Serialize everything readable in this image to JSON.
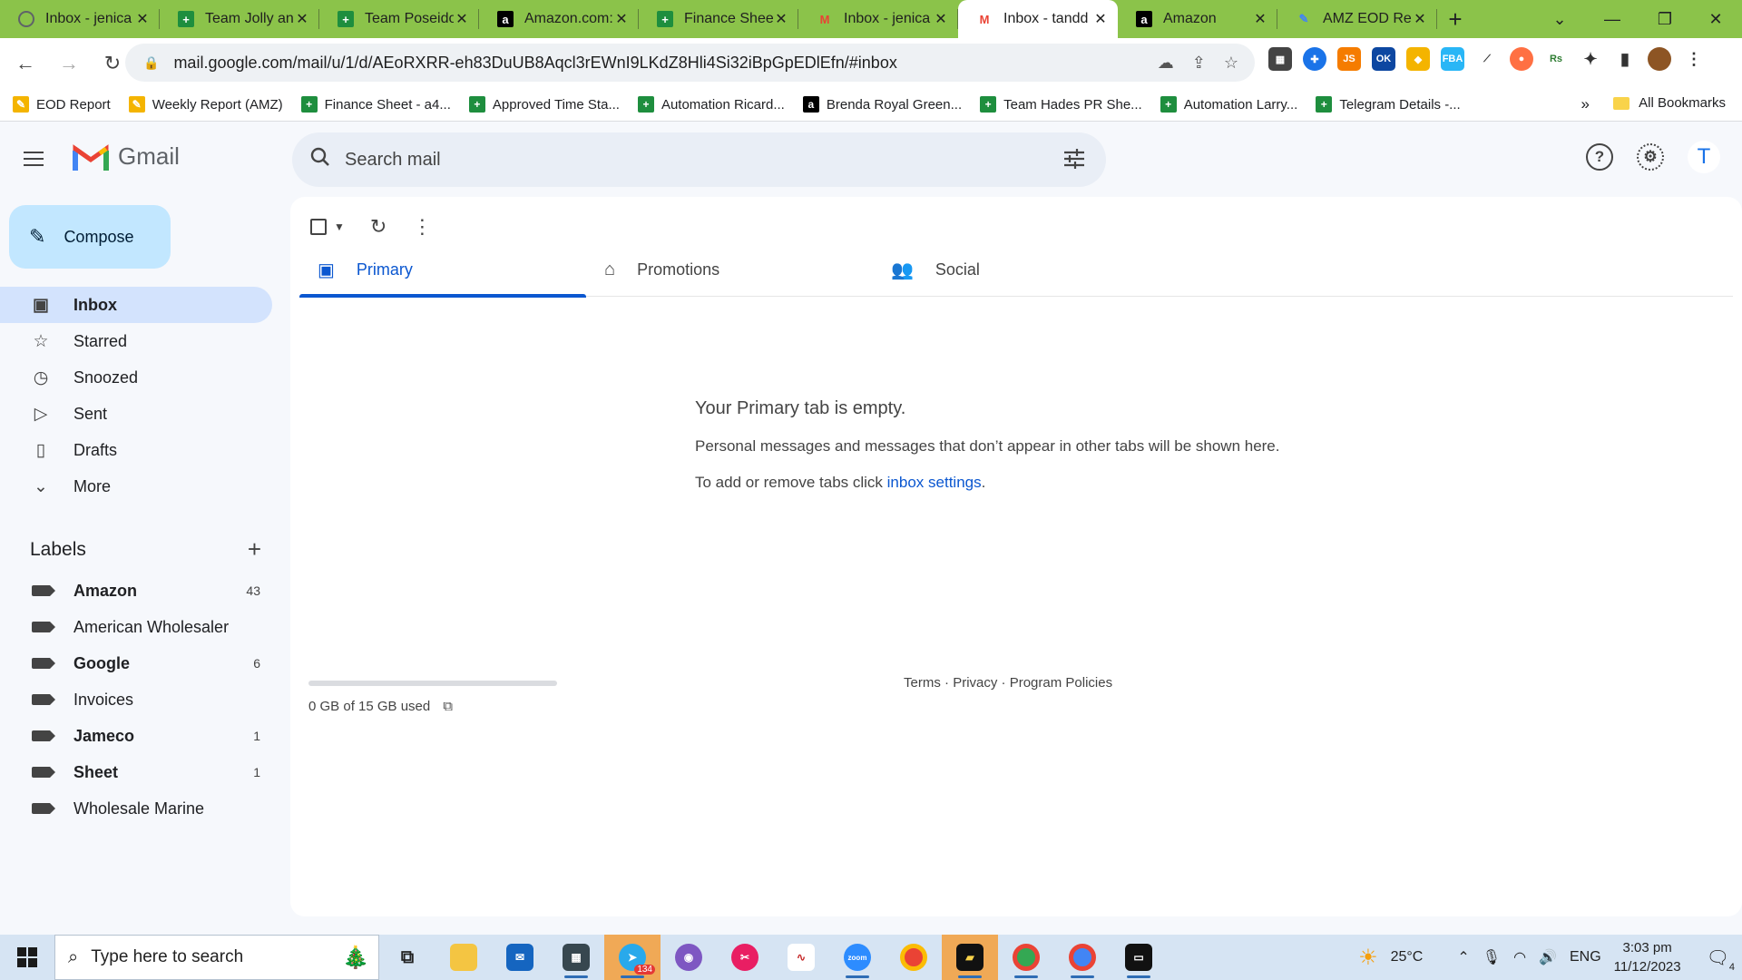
{
  "browser": {
    "tabs": [
      {
        "title": "Inbox - jenica",
        "favicon": "gear-icon"
      },
      {
        "title": "Team Jolly an",
        "favicon": "sheets-icon"
      },
      {
        "title": "Team Poseido",
        "favicon": "sheets-icon"
      },
      {
        "title": "Amazon.com:",
        "favicon": "amazon-icon"
      },
      {
        "title": "Finance Sheet",
        "favicon": "sheets-icon"
      },
      {
        "title": "Inbox - jenica",
        "favicon": "gmail-icon"
      },
      {
        "title": "Inbox - tandd",
        "favicon": "gmail-icon",
        "active": true
      },
      {
        "title": "Amazon",
        "favicon": "amazon-icon"
      },
      {
        "title": "AMZ EOD Re",
        "favicon": "pen-icon"
      }
    ],
    "new_tab": "+",
    "url": "mail.google.com/mail/u/1/d/AEoRXRR-eh83DuUB8Aqcl3rEWnI9LKdZ8Hli4Si32iBpGpEDlEfn/#inbox",
    "bookmarks": [
      {
        "label": "EOD Report",
        "icon": "pen-icon",
        "color": "#f4b400"
      },
      {
        "label": "Weekly Report (AMZ)",
        "icon": "pen-icon",
        "color": "#f4b400"
      },
      {
        "label": "Finance Sheet - a4...",
        "icon": "sheets-icon",
        "color": "#1e8e3e"
      },
      {
        "label": "Approved Time Sta...",
        "icon": "sheets-icon",
        "color": "#1e8e3e"
      },
      {
        "label": "Automation Ricard...",
        "icon": "sheets-icon",
        "color": "#1e8e3e"
      },
      {
        "label": "Brenda Royal Green...",
        "icon": "amazon-icon",
        "color": "#000000"
      },
      {
        "label": "Team Hades PR She...",
        "icon": "sheets-icon",
        "color": "#1e8e3e"
      },
      {
        "label": "Automation Larry...",
        "icon": "sheets-icon",
        "color": "#1e8e3e"
      },
      {
        "label": "Telegram Details -...",
        "icon": "sheets-icon",
        "color": "#1e8e3e"
      }
    ],
    "bookmarks_more": "»",
    "all_bookmarks": "All Bookmarks"
  },
  "gmail": {
    "logo_text": "Gmail",
    "search_placeholder": "Search mail",
    "avatar_letter": "T",
    "compose_label": "Compose",
    "nav": [
      {
        "label": "Inbox",
        "icon": "inbox-icon",
        "active": true
      },
      {
        "label": "Starred",
        "icon": "star-icon"
      },
      {
        "label": "Snoozed",
        "icon": "clock-icon"
      },
      {
        "label": "Sent",
        "icon": "send-icon"
      },
      {
        "label": "Drafts",
        "icon": "draft-icon"
      },
      {
        "label": "More",
        "icon": "chevron-down-icon"
      }
    ],
    "labels_title": "Labels",
    "labels": [
      {
        "name": "Amazon",
        "count": "43",
        "bold": true
      },
      {
        "name": "American Wholesaler",
        "count": "",
        "bold": false
      },
      {
        "name": "Google",
        "count": "6",
        "bold": true
      },
      {
        "name": "Invoices",
        "count": "",
        "bold": false
      },
      {
        "name": "Jameco",
        "count": "1",
        "bold": true
      },
      {
        "name": "Sheet",
        "count": "1",
        "bold": true
      },
      {
        "name": "Wholesale Marine",
        "count": "",
        "bold": false
      }
    ],
    "inbox_tabs": [
      {
        "label": "Primary",
        "icon": "inbox-icon",
        "active": true
      },
      {
        "label": "Promotions",
        "icon": "tag-icon"
      },
      {
        "label": "Social",
        "icon": "people-icon"
      }
    ],
    "empty": {
      "heading": "Your Primary tab is empty.",
      "line1": "Personal messages and messages that don’t appear in other tabs will be shown here.",
      "line2_prefix": "To add or remove tabs click ",
      "line2_link": "inbox settings",
      "line2_suffix": "."
    },
    "storage": {
      "text": "0 GB of 15 GB used",
      "used_fraction": 0
    },
    "footer": {
      "terms": "Terms",
      "privacy": "Privacy",
      "policies": "Program Policies",
      "sep": " · "
    }
  },
  "taskbar": {
    "search_placeholder": "Type here to search",
    "telegram_badge": "134",
    "weather": "25°C",
    "language": "ENG",
    "time": "3:03 pm",
    "date": "11/12/2023",
    "notifications": "4"
  }
}
